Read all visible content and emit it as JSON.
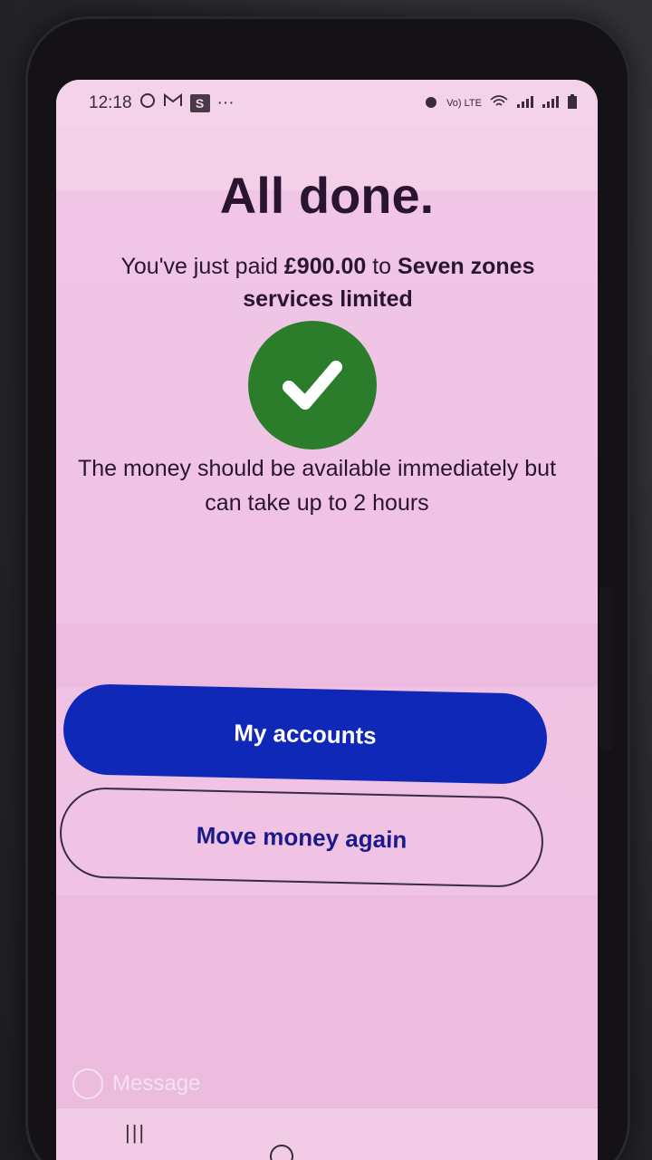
{
  "status_bar": {
    "time": "12:18",
    "notification_icons": [
      "whatsapp-icon",
      "gmail-icon",
      "s-app-icon"
    ],
    "s_badge": "S",
    "more": "···",
    "network": "Vo) LTE"
  },
  "main": {
    "title": "All done.",
    "paid_prefix": "You've just paid",
    "amount": "£900.00",
    "paid_to": "to",
    "payee": "Seven zones services limited",
    "info": "The money should be available immediately but can take up to 2 hours"
  },
  "buttons": {
    "primary_label": "My accounts",
    "secondary_label": "Move money again"
  },
  "keyboard": {
    "message_placeholder": "Message"
  },
  "nav": {
    "recent_glyph": "|||"
  },
  "colors": {
    "screen_bg": "#f0c3e4",
    "primary_button": "#1028b8",
    "success_green": "#2b7d2c",
    "text_dark": "#2a1530"
  }
}
